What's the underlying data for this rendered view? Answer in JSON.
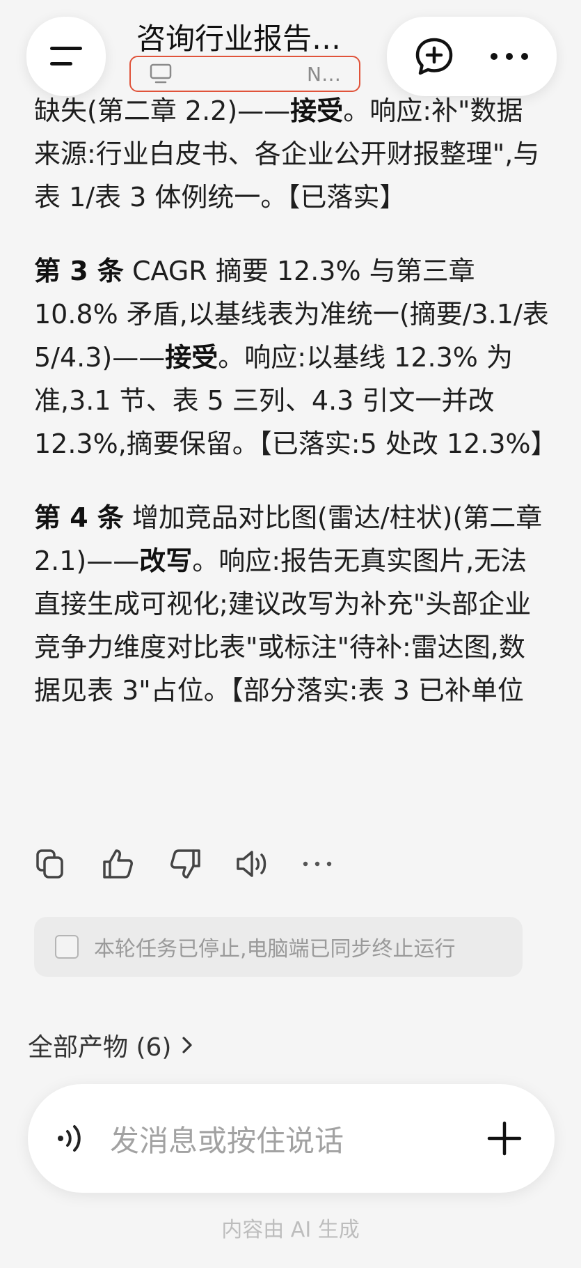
{
  "header": {
    "title": "咨询行业报告…",
    "device_label": "N…",
    "menu_icon": "menu-icon",
    "new_chat_icon": "new-chat-icon",
    "more_icon": "more-icon"
  },
  "message": {
    "p1": {
      "text_a": "缺失(第二章 2.2)——",
      "bold_a": "接受",
      "text_b": "。响应:补\"数据来源:行业白皮书、各企业公开财报整理\",与表 1/表 3 体例统一。【已落实】"
    },
    "p2": {
      "lead": "第 3 条",
      "text_a": " CAGR 摘要 12.3% 与第三章 10.8% 矛盾,以基线表为准统一(摘要/3.1/表 5/4.3)——",
      "bold_a": "接受",
      "text_b": "。响应:以基线 12.3% 为准,3.1 节、表 5 三列、4.3 引文一并改 12.3%,摘要保留。【已落实:5 处改 12.3%】"
    },
    "p3": {
      "lead": "第 4 条",
      "text_a": " 增加竞品对比图(雷达/柱状)(第二章 2.1)——",
      "bold_a": "改写",
      "text_b": "。响应:报告无真实图片,无法直接生成可视化;建议改写为补充\"头部企业竞争力维度对比表\"或标注\"待补:雷达图,数据见表 3\"占位。【部分落实:表 3 已补单位"
    }
  },
  "actions": {
    "copy_icon": "copy-icon",
    "like_icon": "thumbs-up-icon",
    "dislike_icon": "thumbs-down-icon",
    "speaker_icon": "speaker-icon",
    "more_icon": "more-icon"
  },
  "notice": {
    "text": "本轮任务已停止,电脑端已同步终止运行"
  },
  "artifacts": {
    "label": "全部产物 (6)"
  },
  "input": {
    "placeholder": "发消息或按住说话",
    "voice_icon": "voice-icon",
    "plus_icon": "plus-icon"
  },
  "footer": {
    "note": "内容由 AI 生成"
  },
  "colors": {
    "background": "#f5f5f5",
    "highlight_border": "#e0533a",
    "notice_bg": "#ebebeb"
  }
}
